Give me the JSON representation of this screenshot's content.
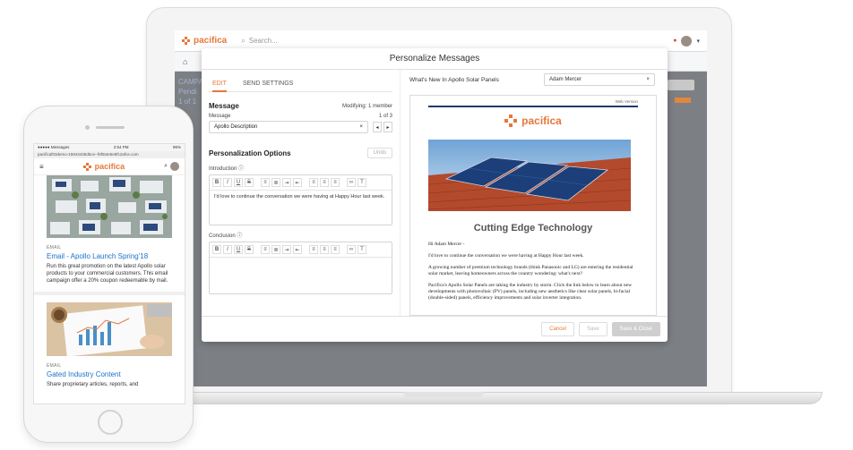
{
  "colors": {
    "accent": "#e5783a",
    "link": "#1a73c9",
    "navy": "#1f3a6e"
  },
  "laptop": {
    "brand": "pacifica",
    "search_placeholder": "Search...",
    "user_menu": "▾",
    "home_icon": "home-icon",
    "bg_left_lines": [
      "CAMPA",
      "Pendi",
      "1 of 1 "
    ],
    "modal": {
      "title": "Personalize Messages",
      "tabs": [
        "EDIT",
        "SEND SETTINGS"
      ],
      "message_heading": "Message",
      "modifying": "Modifying: 1 member",
      "message_label": "Message",
      "message_count": "1 of 3",
      "message_value": "Apollo Description",
      "personalization_heading": "Personalization Options",
      "undo": "Undo",
      "intro_label": "Introduction",
      "intro_text": "I'd love to continue the conversation we were having at Happy Hour last week.",
      "conclusion_label": "Conclusion",
      "preview_title": "What's New In Apollo Solar Panels",
      "recipient": "Adam Mercer",
      "email": {
        "web_version": "Web Version",
        "brand": "pacifica",
        "heading": "Cutting Edge Technology",
        "greeting": "Hi Adam Mercer -",
        "p1": "I'd love to continue the conversation we were having at Happy Hour last week.",
        "p2": "A growing number of premium technology brands (think Panasonic and LG) are entering the residential solar market, leaving homeowners across the country wondering: what's next?",
        "p3": "Pacifica's Apollo Solar Panels are taking the industry by storm. Click the link below to learn about new developments with photovoltaic (PV) panels, including new aesthetics like clear solar panels, bi-facial (double-sided) panels, efficiency improvements and solar inverter integration."
      },
      "buttons": {
        "cancel": "Cancel",
        "save": "Save",
        "save_close": "Save & Close"
      }
    }
  },
  "phone": {
    "status_left": "●●●●● Messages",
    "status_time": "2:54 PM",
    "status_right": "96%",
    "url": "pacificaf03demo-15943436d5ce--f6f6t4e5e8fc2afce.com",
    "brand": "pacifica",
    "cards": [
      {
        "kind": "EMAIL",
        "title": "Email - Apollo Launch Spring'18",
        "desc": "Run this great promotion on the latest Apollo solar products to your commercial customers. This email campaign offer a 20% coupon redeemable by mail."
      },
      {
        "kind": "EMAIL",
        "title": "Gated Industry Content",
        "desc": "Share proprietary articles, reports, and"
      }
    ]
  }
}
